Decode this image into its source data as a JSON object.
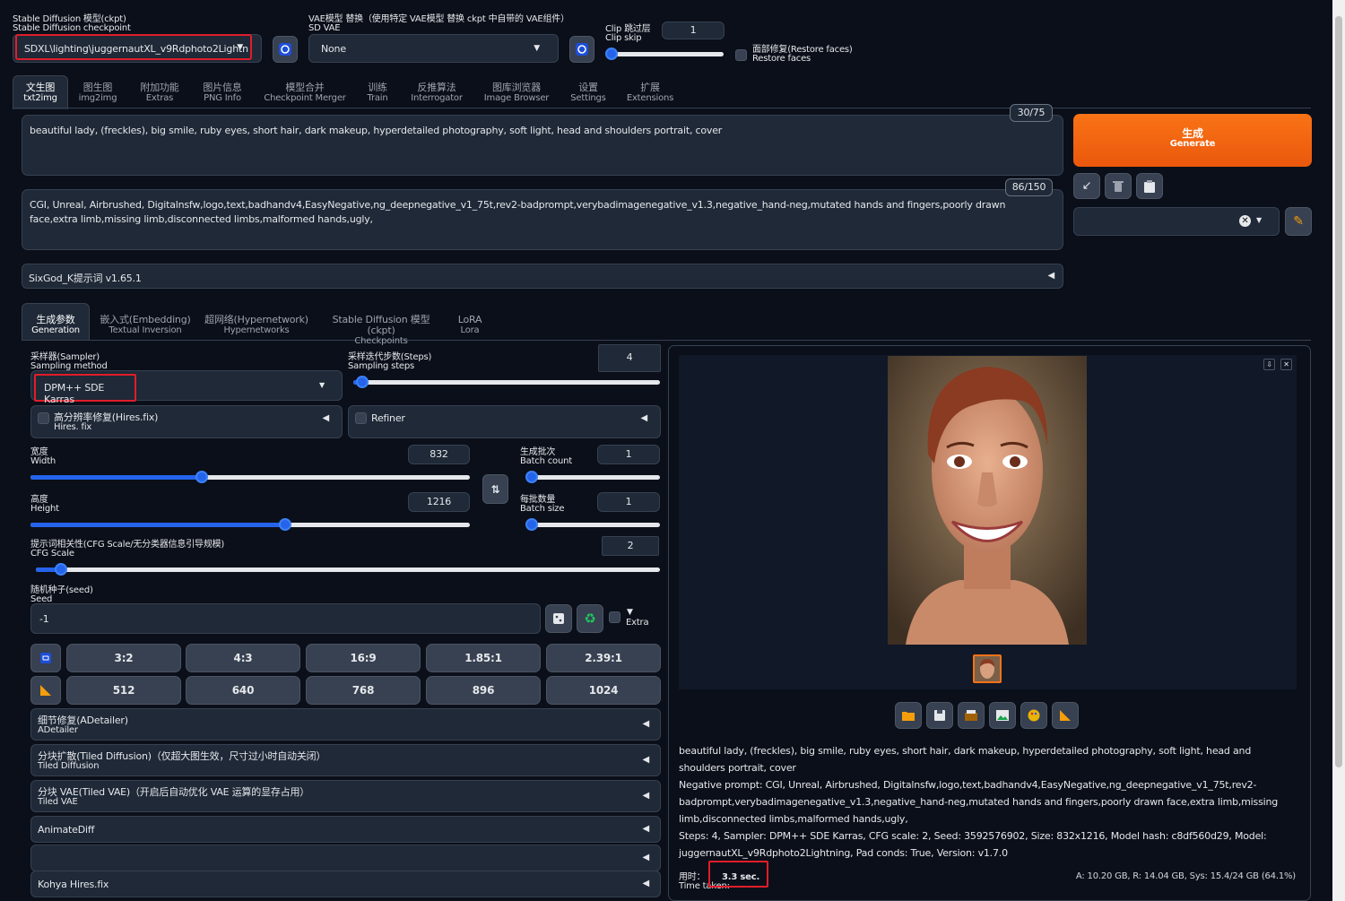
{
  "checkpoint": {
    "label_cn": "Stable Diffusion 模型(ckpt)",
    "label_en": "Stable Diffusion checkpoint",
    "value": "SDXL\\lighting\\juggernautXL_v9Rdphoto2Lightn"
  },
  "vae": {
    "label_cn": "VAE模型 替换（使用特定 VAE模型 替换 ckpt 中自带的 VAE组件）",
    "label_en": "SD VAE",
    "value": "None"
  },
  "clip_skip": {
    "label_cn": "Clip 跳过层",
    "label_en": "Clip skip",
    "value": "1"
  },
  "restore_faces": {
    "label_cn": "面部修复(Restore faces)",
    "label_en": "Restore faces"
  },
  "tabs": [
    {
      "cn": "文生图",
      "en": "txt2img"
    },
    {
      "cn": "图生图",
      "en": "img2img"
    },
    {
      "cn": "附加功能",
      "en": "Extras"
    },
    {
      "cn": "图片信息",
      "en": "PNG Info"
    },
    {
      "cn": "模型合并",
      "en": "Checkpoint Merger"
    },
    {
      "cn": "训练",
      "en": "Train"
    },
    {
      "cn": "反推算法",
      "en": "Interrogator"
    },
    {
      "cn": "图库浏览器",
      "en": "Image Browser"
    },
    {
      "cn": "设置",
      "en": "Settings"
    },
    {
      "cn": "扩展",
      "en": "Extensions"
    }
  ],
  "prompt": {
    "text": "beautiful lady, (freckles), big smile, ruby eyes, short hair, dark makeup, hyperdetailed photography, soft light, head and shoulders portrait, cover",
    "counter": "30/75"
  },
  "negative": {
    "text": "CGI, Unreal, Airbrushed, Digitalnsfw,logo,text,badhandv4,EasyNegative,ng_deepnegative_v1_75t,rev2-badprompt,verybadimagenegative_v1.3,negative_hand-neg,mutated hands and fingers,poorly drawn face,extra limb,missing limb,disconnected limbs,malformed hands,ugly,",
    "counter": "86/150"
  },
  "generate": {
    "cn": "生成",
    "en": "Generate"
  },
  "sixgod": "SixGod_K提示词 v1.65.1",
  "subtabs": [
    {
      "cn": "生成参数",
      "en": "Generation"
    },
    {
      "cn": "嵌入式(Embedding)",
      "en": "Textual Inversion"
    },
    {
      "cn": "超网络(Hypernetwork)",
      "en": "Hypernetworks"
    },
    {
      "cn": "Stable Diffusion 模型(ckpt)",
      "en": "Checkpoints"
    },
    {
      "cn": "LoRA",
      "en": "Lora"
    }
  ],
  "sampler": {
    "label_cn": "采样器(Sampler)",
    "label_en": "Sampling method",
    "value": "DPM++ SDE Karras"
  },
  "steps": {
    "label_cn": "采样迭代步数(Steps)",
    "label_en": "Sampling steps",
    "value": "4",
    "level": 0.03
  },
  "hires": {
    "cn": "高分辨率修复(Hires.fix)",
    "en": "Hires. fix"
  },
  "refiner": "Refiner",
  "width": {
    "cn": "宽度",
    "en": "Width",
    "value": "832",
    "level": 0.39
  },
  "height": {
    "cn": "高度",
    "en": "Height",
    "value": "1216",
    "level": 0.58
  },
  "batch_count": {
    "cn": "生成批次",
    "en": "Batch count",
    "value": "1",
    "level": 0
  },
  "batch_size": {
    "cn": "每批数量",
    "en": "Batch size",
    "value": "1",
    "level": 0
  },
  "cfg": {
    "cn": "提示词相关性(CFG Scale/无分类器信息引导规模)",
    "en": "CFG Scale",
    "value": "2",
    "level": 0.04
  },
  "seed": {
    "cn": "随机种子(seed)",
    "en": "Seed",
    "value": "-1",
    "extra": "Extra"
  },
  "ratios": [
    "3:2",
    "4:3",
    "16:9",
    "1.85:1",
    "2.39:1"
  ],
  "sizes": [
    "512",
    "640",
    "768",
    "896",
    "1024"
  ],
  "accordions": [
    {
      "cn": "细节修复(ADetailer)",
      "en": "ADetailer"
    },
    {
      "cn": "分块扩散(Tiled Diffusion)（仅超大图生效，尺寸过小时自动关闭）",
      "en": "Tiled Diffusion"
    },
    {
      "cn": "分块 VAE(Tiled VAE)（开启后自动优化 VAE 运算的显存占用）",
      "en": "Tiled VAE"
    },
    {
      "cn": "AnimateDiff",
      "en": ""
    },
    {
      "cn": "",
      "en": ""
    },
    {
      "cn": "Kohya Hires.fix",
      "en": ""
    }
  ],
  "output": {
    "prompt": "beautiful lady, (freckles), big smile, ruby eyes, short hair, dark makeup, hyperdetailed photography, soft light, head and shoulders portrait, cover",
    "negative": "Negative prompt: CGI, Unreal, Airbrushed, Digitalnsfw,logo,text,badhandv4,EasyNegative,ng_deepnegative_v1_75t,rev2-badprompt,verybadimagenegative_v1.3,negative_hand-neg,mutated hands and fingers,poorly drawn face,extra limb,missing limb,disconnected limbs,malformed hands,ugly,",
    "params": "Steps: 4, Sampler: DPM++ SDE Karras, CFG scale: 2, Seed: 3592576902, Size: 832x1216, Model hash: c8df560d29, Model: juggernautXL_v9Rdphoto2Lightning, Pad conds: True, Version: v1.7.0",
    "time_cn": "用时：",
    "time_en": "Time taken:",
    "time_value": "3.3 sec.",
    "vram": "A: 10.20 GB, R: 14.04 GB, Sys: 15.4/24 GB (64.1%)"
  },
  "colors": {
    "accent": "#2563eb",
    "generate": "#f97316",
    "highlight": "#e11d2a",
    "bg": "#0b0f19"
  }
}
